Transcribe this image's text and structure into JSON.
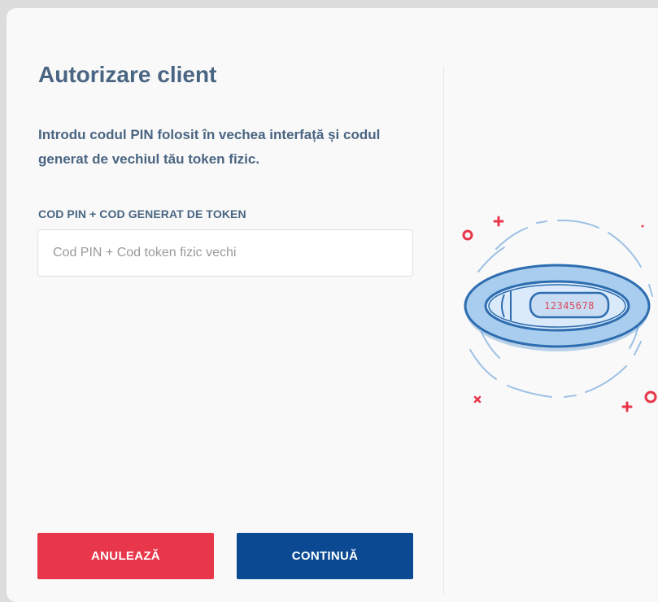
{
  "page": {
    "title": "Autorizare client",
    "intro": "Introdu codul PIN folosit în vechea interfață și codul generat de vechiul tău token fizic."
  },
  "form": {
    "label": "COD PIN + COD GENERAT DE TOKEN",
    "placeholder": "Cod PIN + Cod token fizic vechi",
    "value": ""
  },
  "illustration": {
    "token_code": "12345678",
    "icon": "hardware-token-icon"
  },
  "buttons": {
    "cancel": "ANULEAZĂ",
    "continue": "CONTINUĂ"
  },
  "colors": {
    "heading": "#4a6582",
    "cancel": "#e8364a",
    "continue": "#0b4a92",
    "token_blue": "#3e87c9",
    "accent_red": "#e8364a"
  }
}
